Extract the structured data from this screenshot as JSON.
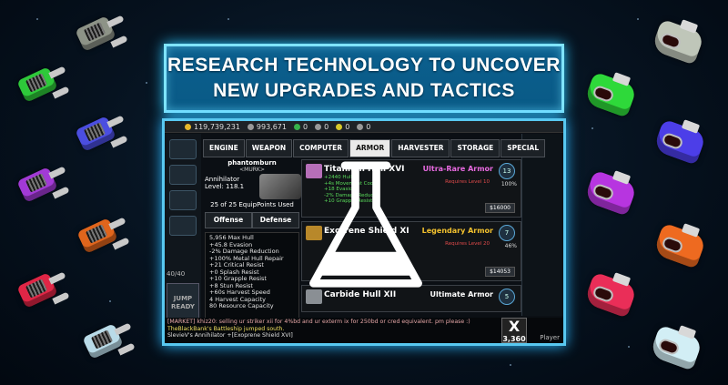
{
  "banner": {
    "line1": "RESEARCH TECHNOLOGY TO UNCOVER",
    "line2": "NEW UPGRADES AND TACTICS"
  },
  "colors": {
    "banner_border": "#7fe4ff",
    "banner_fill": "#0b5f8e",
    "panel_glow": "#58c8f0",
    "ultra_rare": "#e86ae0",
    "legendary": "#f2c12e",
    "ultimate": "#ffffff"
  },
  "resources": {
    "credits": "119,739,231",
    "metal": "993,671",
    "r3": "0",
    "r4": "0",
    "r5": "0",
    "r6": "0"
  },
  "tabs": [
    "ENGINE",
    "WEAPON",
    "COMPUTER",
    "ARMOR",
    "HARVESTER",
    "STORAGE",
    "SPECIAL"
  ],
  "active_tab": "ARMOR",
  "ship": {
    "name": "phantomburn",
    "tag": "<MURK>",
    "type": "Annihilator",
    "level": "Level: 118.1",
    "equip": "25 of 25 EquipPoints Used",
    "offense_label": "Offense",
    "defense_label": "Defense"
  },
  "stats": [
    "5,956 Max Hull",
    "+45.8 Evasion",
    "-2% Damage Reduction",
    "+100% Metal Hull Repair",
    "+21 Critical Resist",
    "+0 Splash Resist",
    "+10 Grapple Resist",
    "+8 Stun Resist",
    "+60s Harvest Speed",
    "4 Harvest Capacity",
    "80 Resource Capacity"
  ],
  "items": [
    {
      "title": "Titanium Hull XVI",
      "rarity": "Ultra-Rare Armor",
      "requires": "Requires Level 10",
      "badge": "13",
      "pct": "100%",
      "price": "$16000",
      "mods": [
        "+2440 Hull",
        "+4s Movement Cool",
        "+18 Evasion",
        "-2% Damage Reduce",
        "+10 Grapple Resist"
      ]
    },
    {
      "title": "Exotrene Shield XI",
      "rarity": "Legendary Armor",
      "requires": "Requires Level 20",
      "badge": "7",
      "pct": "46%",
      "price": "$14053"
    },
    {
      "title": "Carbide Hull XII",
      "rarity": "Ultimate Armor",
      "badge": "5"
    }
  ],
  "sidebar": {
    "capacity": "40/40",
    "jump": "JUMP READY"
  },
  "chat": {
    "line1": "[MARKET] khiz20: selling ur striker xii for 4%bd and ur exterm ix for 250bd or cred equivalent. pm please :)",
    "line2": "TheBlackBank's Battleship jumped south.",
    "line3": "SlevieV's Annihilator +[Exoprene Shield XVI]"
  },
  "close_counter": {
    "x": "X",
    "value": "3,360"
  },
  "player_label": "Player"
}
